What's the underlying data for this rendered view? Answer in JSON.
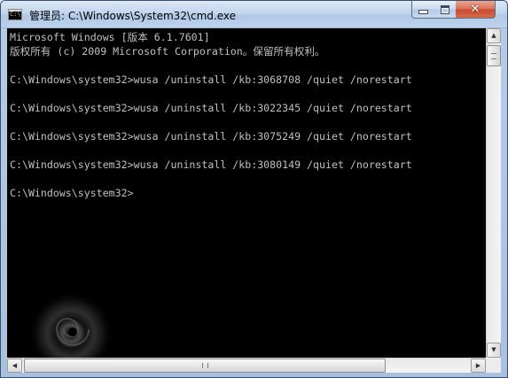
{
  "window": {
    "title": "管理员: C:\\Windows\\System32\\cmd.exe",
    "icon": "cmd-icon",
    "controls": {
      "minimize_icon": "minimize-icon",
      "maximize_icon": "maximize-icon",
      "close_icon": "close-icon",
      "close_glyph": "✕"
    }
  },
  "console": {
    "lines": [
      "Microsoft Windows [版本 6.1.7601]",
      "版权所有 (c) 2009 Microsoft Corporation。保留所有权利。",
      "",
      "C:\\Windows\\system32>wusa /uninstall /kb:3068708 /quiet /norestart",
      "",
      "C:\\Windows\\system32>wusa /uninstall /kb:3022345 /quiet /norestart",
      "",
      "C:\\Windows\\system32>wusa /uninstall /kb:3075249 /quiet /norestart",
      "",
      "C:\\Windows\\system32>wusa /uninstall /kb:3080149 /quiet /norestart",
      "",
      "C:\\Windows\\system32>"
    ],
    "text_color": "#c0c0c0",
    "background": "#000000"
  },
  "scrollbars": {
    "up_arrow": "▲",
    "down_arrow": "▼",
    "left_arrow": "◀",
    "right_arrow": "▶"
  }
}
